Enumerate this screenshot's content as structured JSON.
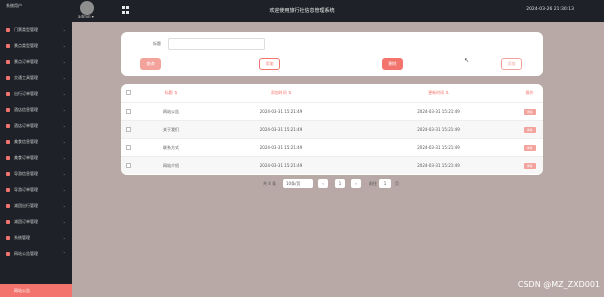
{
  "header": {
    "user_label": "系统用户",
    "avatar_name": "admin ▾",
    "title": "欢迎使用旅行社信息管理系统",
    "clock": "2024-03-26 21:30:13"
  },
  "sidebar": {
    "items": [
      {
        "label": "系统用户"
      },
      {
        "label": "门票类型管理"
      },
      {
        "label": "景点类型管理"
      },
      {
        "label": "景点订单管理"
      },
      {
        "label": "交通工具管理"
      },
      {
        "label": "出行订单管理"
      },
      {
        "label": "酒店信息管理"
      },
      {
        "label": "酒店订单管理"
      },
      {
        "label": "美食信息管理"
      },
      {
        "label": "美食订单管理"
      },
      {
        "label": "导游信息管理"
      },
      {
        "label": "导游订单管理"
      },
      {
        "label": "减团出行管理"
      },
      {
        "label": "减团订单管理"
      },
      {
        "label": "系统管理"
      },
      {
        "label": "网站公告管理"
      }
    ],
    "active_sub": "网站公告"
  },
  "search": {
    "label": "标题",
    "placeholder": "",
    "search_btn": "查询",
    "add_btn": "添加",
    "delete_btn": "删除",
    "other_btn": "添加"
  },
  "table": {
    "headers": {
      "title": "标题 ⇅",
      "time1": "添加时间 ⇅",
      "time2": "更新时间 ⇅",
      "op": "操作"
    },
    "rows": [
      {
        "title": "网站公告",
        "time1": "2024-03-31 15:21:49",
        "time2": "2024-03-31 15:21:49",
        "op": "详情"
      },
      {
        "title": "关于我们",
        "time1": "2024-03-31 15:21:49",
        "time2": "2024-03-31 15:21:49",
        "op": "详情"
      },
      {
        "title": "联系方式",
        "time1": "2024-03-31 15:21:49",
        "time2": "2024-03-31 15:21:49",
        "op": "详情"
      },
      {
        "title": "网站介绍",
        "time1": "2024-03-31 15:21:49",
        "time2": "2024-03-31 15:21:49",
        "op": "详情"
      }
    ]
  },
  "pager": {
    "total": "共 4 条",
    "size": "10条/页",
    "prev": "‹",
    "page": "1",
    "next": "›",
    "goto": "前往",
    "goto_value": "1",
    "unit": "页"
  },
  "watermark": "CSDN @MZ_ZXD001",
  "colors": {
    "accent": "#f3746c",
    "accent_light": "#f3a29c",
    "sidebar_bg": "#1f2128",
    "page_bg": "#b8a9a6"
  }
}
